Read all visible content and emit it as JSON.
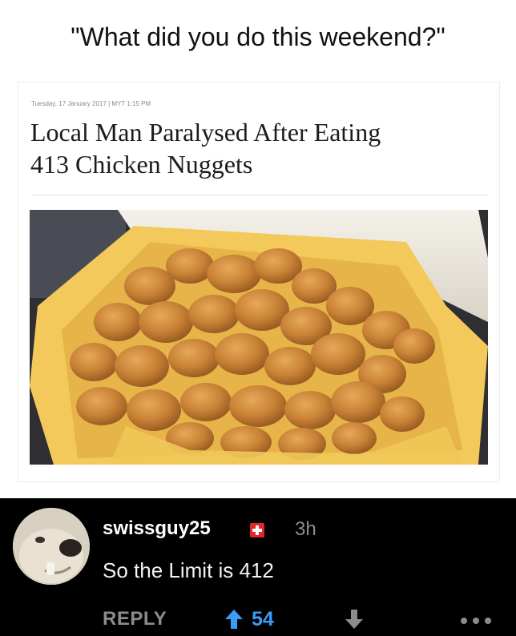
{
  "post": {
    "caption": "\"What did you do this weekend?\""
  },
  "article": {
    "dateline": "Tuesday, 17 January 2017 | MYT 1:15 PM",
    "headline_line1": "Local Man Paralysed After Eating",
    "headline_line2": "413 Chicken Nuggets",
    "image_icon": "chicken-nuggets-photo"
  },
  "comment": {
    "username": "swissguy25",
    "flag_icon": "swiss-flag-icon",
    "time": "3h",
    "text": "So the Limit is 412",
    "reply_label": "REPLY",
    "score": "54",
    "colors": {
      "background": "#000000",
      "username": "#ffffff",
      "muted": "#8c8c8c",
      "upvote_accent": "#3b9cf5"
    }
  }
}
